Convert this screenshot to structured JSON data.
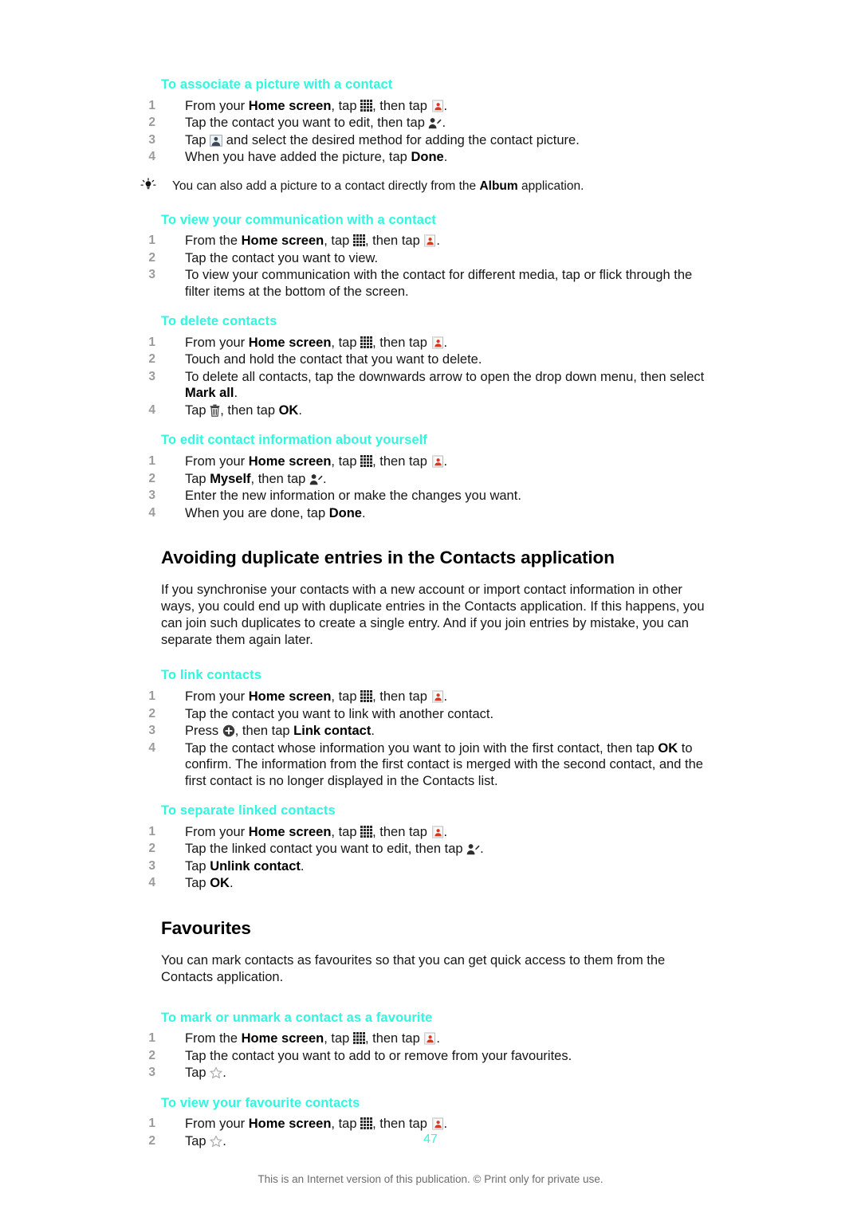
{
  "page": {
    "number": "47",
    "copyright": "This is an Internet version of this publication. © Print only for private use."
  },
  "sections": {
    "associate_picture": {
      "heading": "To associate a picture with a contact",
      "steps": [
        "From your |b:Home screen|, tap |icon:grid-icon|, then tap |icon:contacts-icon|.",
        "Tap the contact you want to edit, then tap |icon:edit-person-icon|.",
        "Tap |icon:picture-icon| and select the desired method for adding the contact picture.",
        "When you have added the picture, tap |b:Done|."
      ],
      "tip": "You can also add a picture to a contact directly from the |b:Album| application."
    },
    "view_communication": {
      "heading": "To view your communication with a contact",
      "steps": [
        "From the |b:Home screen|, tap |icon:grid-icon|, then tap |icon:contacts-icon|.",
        "Tap the contact you want to view.",
        "To view your communication with the contact for different media, tap or flick through the filter items at the bottom of the screen."
      ]
    },
    "delete_contacts": {
      "heading": "To delete contacts",
      "steps": [
        "From your |b:Home screen|, tap |icon:grid-icon|, then tap |icon:contacts-icon|.",
        "Touch and hold the contact that you want to delete.",
        "To delete all contacts, tap the downwards arrow to open the drop down menu, then select |b:Mark all|.",
        "Tap |icon:trash-icon|, then tap |b:OK|."
      ]
    },
    "edit_own_info": {
      "heading": "To edit contact information about yourself",
      "steps": [
        "From your |b:Home screen|, tap |icon:grid-icon|, then tap |icon:contacts-icon|.",
        "Tap |b:Myself|, then tap |icon:edit-person-icon|.",
        "Enter the new information or make the changes you want.",
        "When you are done, tap |b:Done|."
      ]
    },
    "avoid_duplicates": {
      "heading": "Avoiding duplicate entries in the Contacts application",
      "body": "If you synchronise your contacts with a new account or import contact information in other ways, you could end up with duplicate entries in the Contacts application. If this happens, you can join such duplicates to create a single entry. And if you join entries by mistake, you can separate them again later."
    },
    "link_contacts": {
      "heading": "To link contacts",
      "steps": [
        "From your |b:Home screen|, tap |icon:grid-icon|, then tap |icon:contacts-icon|.",
        "Tap the contact you want to link with another contact.",
        "Press |icon:plus-circle-icon|, then tap |b:Link contact|.",
        "Tap the contact whose information you want to join with the first contact, then tap |b:OK| to confirm. The information from the first contact is merged with the second contact, and the first contact is no longer displayed in the Contacts list."
      ]
    },
    "separate_linked": {
      "heading": "To separate linked contacts",
      "steps": [
        "From your |b:Home screen|, tap |icon:grid-icon|, then tap |icon:contacts-icon|.",
        "Tap the linked contact you want to edit, then tap |icon:edit-person-icon|.",
        "Tap |b:Unlink contact|.",
        "Tap |b:OK|."
      ]
    },
    "favourites": {
      "heading": "Favourites",
      "body": "You can mark contacts as favourites so that you can get quick access to them from the Contacts application."
    },
    "mark_favourite": {
      "heading": "To mark or unmark a contact as a favourite",
      "steps": [
        "From the |b:Home screen|, tap |icon:grid-icon|, then tap |icon:contacts-icon|.",
        "Tap the contact you want to add to or remove from your favourites.",
        "Tap |icon:star-icon|."
      ]
    },
    "view_favourites": {
      "heading": "To view your favourite contacts",
      "steps": [
        "From your |b:Home screen|, tap |icon:grid-icon|, then tap |icon:contacts-icon|.",
        "Tap |icon:star-icon|."
      ]
    }
  },
  "colors": {
    "heading_accent": "#2ff7e0",
    "step_number": "#9b9b9b",
    "body_text": "#161616",
    "footer_text": "#6d6d6d"
  },
  "icons": {
    "grid-icon": "app-drawer grid of squares",
    "contacts-icon": "contacts card with red person",
    "edit-person-icon": "person silhouette with pencil",
    "picture-icon": "photo thumbnail",
    "trash-icon": "waste bin",
    "plus-circle-icon": "dark circle with plus",
    "star-icon": "star outline",
    "bulb-icon": "light bulb tip"
  }
}
